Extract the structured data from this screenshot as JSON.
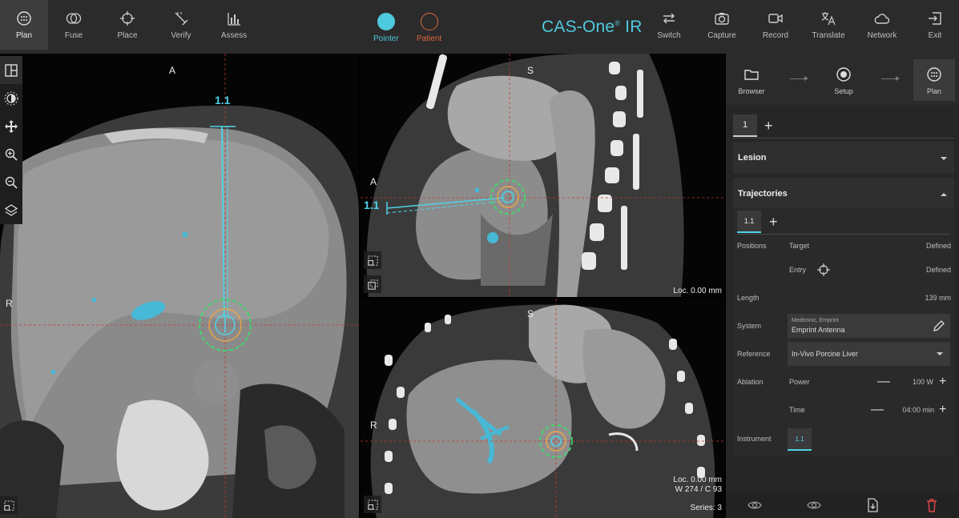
{
  "toolbar": {
    "items": [
      {
        "label": "Plan",
        "icon": "plan-icon"
      },
      {
        "label": "Fuse",
        "icon": "fuse-icon"
      },
      {
        "label": "Place",
        "icon": "place-icon"
      },
      {
        "label": "Verify",
        "icon": "verify-icon"
      },
      {
        "label": "Assess",
        "icon": "assess-icon"
      }
    ],
    "modes": [
      {
        "label": "Pointer",
        "color": "#4fc9dd"
      },
      {
        "label": "Patient",
        "color": "#e0673c"
      }
    ],
    "brand": "CAS-One",
    "brand_mark": "®",
    "brand_suffix": "IR",
    "right_items": [
      {
        "label": "Switch",
        "icon": "switch-icon"
      },
      {
        "label": "Capture",
        "icon": "camera-icon"
      },
      {
        "label": "Record",
        "icon": "video-icon"
      },
      {
        "label": "Translate",
        "icon": "translate-icon"
      },
      {
        "label": "Network",
        "icon": "cloud-icon"
      },
      {
        "label": "Exit",
        "icon": "exit-icon"
      }
    ]
  },
  "viewports": {
    "axial": {
      "top": "A",
      "left": "R",
      "trajectory": "1.1"
    },
    "sagittal": {
      "top": "S",
      "left": "A",
      "trajectory": "1.1",
      "loc": "Loc. 0.00 mm"
    },
    "coronal": {
      "top": "S",
      "left": "R",
      "loc": "Loc. 0.00 mm",
      "window": "W 274 / C 93",
      "series": "Series: 3"
    }
  },
  "panel": {
    "workflow": [
      {
        "label": "Browser",
        "icon": "folder-icon"
      },
      {
        "label": "Setup",
        "icon": "setup-icon"
      },
      {
        "label": "Plan",
        "icon": "plan-icon"
      }
    ],
    "plan_tab": "1",
    "lesion": "Lesion",
    "trajectories": "Trajectories",
    "traj_tab": "1.1",
    "rows": {
      "positions": "Positions",
      "target": "Target",
      "target_state": "Defined",
      "entry": "Entry",
      "entry_state": "Defined",
      "length": "Length",
      "length_value": "139 mm",
      "system": "System",
      "system_vendor": "Medtronic, Emprint",
      "system_name": "Emprint Antenna",
      "reference": "Reference",
      "reference_value": "In-Vivo Porcine Liver",
      "ablation": "Ablation",
      "power": "Power",
      "power_value": "100 W",
      "time": "Time",
      "time_value": "04:00 min",
      "instrument": "Instrument",
      "instrument_value": "1.1"
    },
    "colors": {
      "accent": "#4fd2e6",
      "delete": "#e04848"
    }
  }
}
